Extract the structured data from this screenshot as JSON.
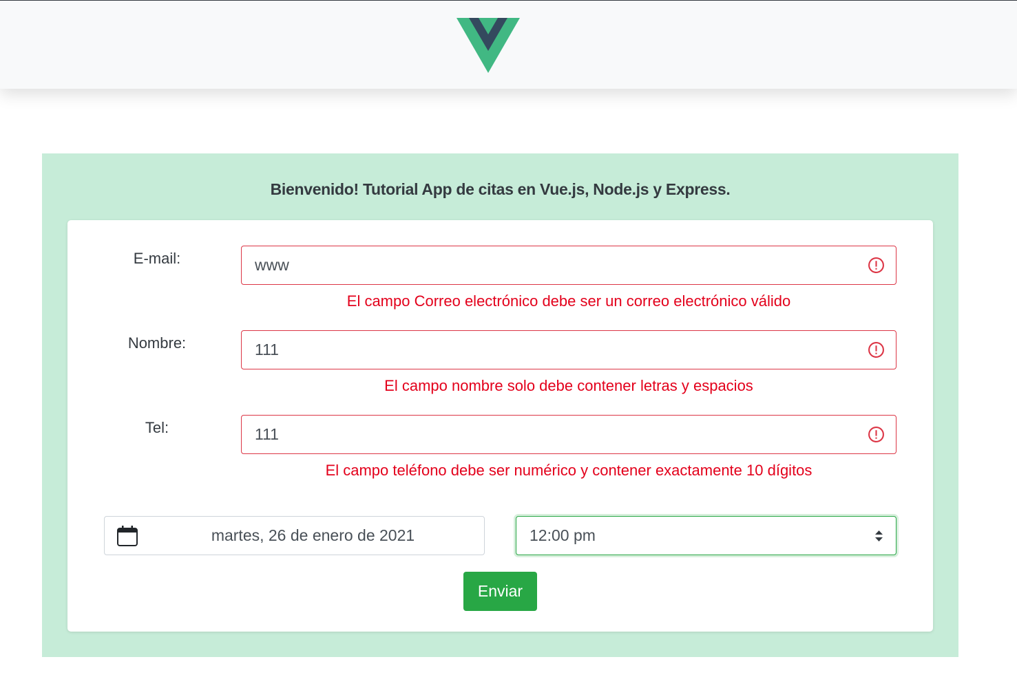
{
  "header": {
    "logo_icon": "vue-logo",
    "logo_colors": {
      "outer": "#41b883",
      "inner": "#34495e"
    }
  },
  "main": {
    "title": "Bienvenido! Tutorial App de citas en Vue.js, Node.js y Express."
  },
  "form": {
    "email": {
      "label": "E-mail:",
      "value": "www",
      "error": "El campo Correo electrónico debe ser un correo electrónico válido",
      "icon": "exclamation-circle-icon"
    },
    "name": {
      "label": "Nombre:",
      "value": "111",
      "error": "El campo nombre solo debe contener letras y espacios",
      "icon": "exclamation-circle-icon"
    },
    "phone": {
      "label": "Tel:",
      "value": "111",
      "error": "El campo teléfono debe ser numérico y contener exactamente 10 dígitos",
      "icon": "exclamation-circle-icon"
    },
    "date": {
      "value": "martes, 26 de enero de 2021",
      "icon": "calendar-icon"
    },
    "time": {
      "value": "12:00 pm",
      "icon": "sort-arrows-icon"
    },
    "submit_label": "Enviar"
  },
  "colors": {
    "panel_bg": "#c6ecd8",
    "error": "#e3001b",
    "error_border": "#dc3545",
    "button": "#28a745"
  }
}
